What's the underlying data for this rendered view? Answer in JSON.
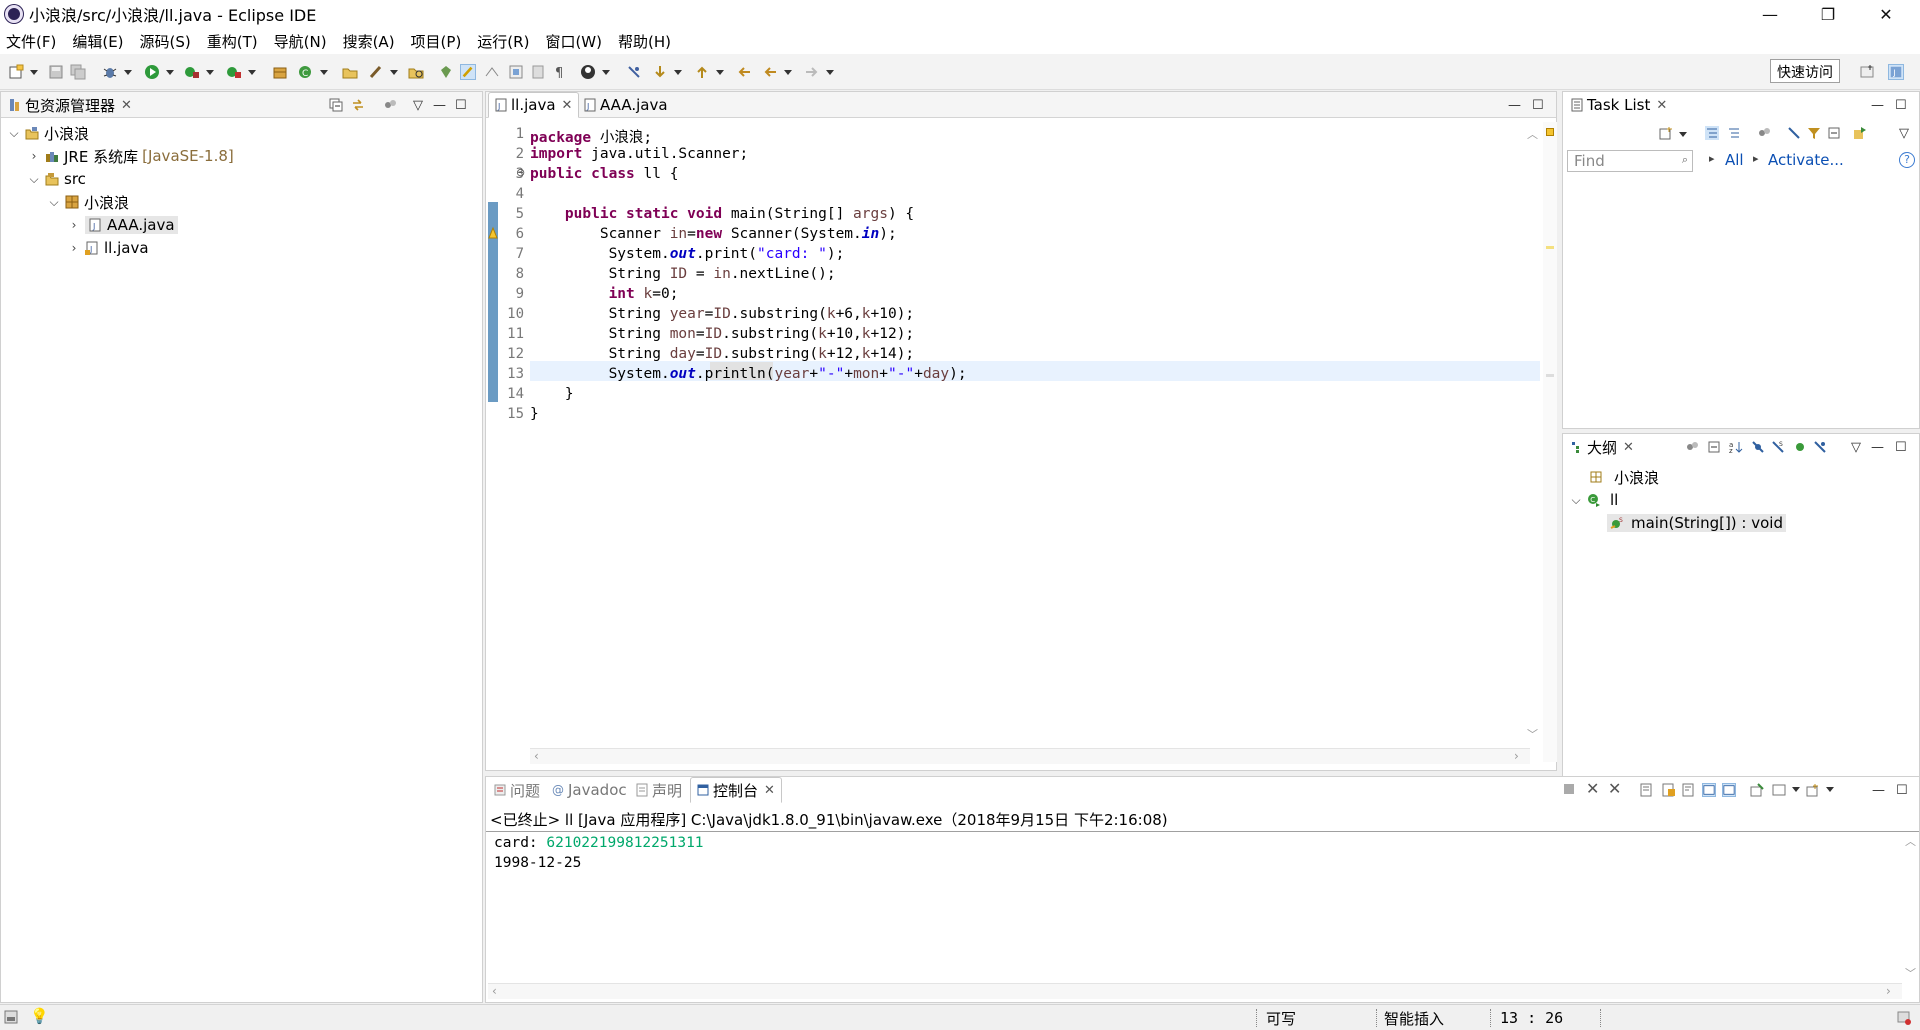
{
  "window": {
    "title": "小浪浪/src/小浪浪/ll.java - Eclipse IDE",
    "minimize": "—",
    "restore": "❐",
    "close": "✕"
  },
  "menu": [
    "文件(F)",
    "编辑(E)",
    "源码(S)",
    "重构(T)",
    "导航(N)",
    "搜索(A)",
    "项目(P)",
    "运行(R)",
    "窗口(W)",
    "帮助(H)"
  ],
  "toolbar": {
    "quick_access": "快速访问"
  },
  "package_explorer": {
    "tab_label": "包资源管理器",
    "tree": [
      {
        "label": "小浪浪",
        "level": 0,
        "expanded": true,
        "icon": "project-icon"
      },
      {
        "label": "JRE 系统库",
        "suffix": "[JavaSE-1.8]",
        "level": 1,
        "expanded": false,
        "icon": "library-icon"
      },
      {
        "label": "src",
        "level": 1,
        "expanded": true,
        "icon": "source-folder-icon"
      },
      {
        "label": "小浪浪",
        "level": 2,
        "expanded": true,
        "icon": "package-icon"
      },
      {
        "label": "AAA.java",
        "level": 3,
        "expanded": false,
        "icon": "java-file-icon",
        "selected": true
      },
      {
        "label": "ll.java",
        "level": 3,
        "expanded": false,
        "icon": "java-file-icon"
      }
    ]
  },
  "editor": {
    "tabs": [
      {
        "label": "ll.java",
        "active": true
      },
      {
        "label": "AAA.java",
        "active": false
      }
    ],
    "line_numbers": [
      "1",
      "2",
      "3",
      "4",
      "5",
      "6",
      "7",
      "8",
      "9",
      "10",
      "11",
      "12",
      "13",
      "14",
      "15"
    ],
    "lines": [
      [
        [
          "kw",
          "package"
        ],
        [
          "t",
          " 小浪浪;"
        ]
      ],
      [
        [
          "kw",
          "import"
        ],
        [
          "t",
          " java.util.Scanner;"
        ]
      ],
      [
        [
          "kw",
          "public"
        ],
        [
          "t",
          " "
        ],
        [
          "kw",
          "class"
        ],
        [
          "t",
          " ll {"
        ]
      ],
      [
        [
          "t",
          ""
        ]
      ],
      [
        [
          "t",
          "    "
        ],
        [
          "kw",
          "public"
        ],
        [
          "t",
          " "
        ],
        [
          "kw",
          "static"
        ],
        [
          "t",
          " "
        ],
        [
          "kw",
          "void"
        ],
        [
          "t",
          " main(String[] "
        ],
        [
          "var",
          "args"
        ],
        [
          "t",
          ") {"
        ]
      ],
      [
        [
          "t",
          "        Scanner "
        ],
        [
          "var",
          "in"
        ],
        [
          "t",
          "="
        ],
        [
          "kw",
          "new"
        ],
        [
          "t",
          " Scanner(System."
        ],
        [
          "fld",
          "in"
        ],
        [
          "t",
          ");"
        ]
      ],
      [
        [
          "t",
          "         System."
        ],
        [
          "fld",
          "out"
        ],
        [
          "t",
          ".print("
        ],
        [
          "str",
          "\"card: \""
        ],
        [
          "t",
          ");"
        ]
      ],
      [
        [
          "t",
          "         String "
        ],
        [
          "var",
          "ID"
        ],
        [
          "t",
          " = "
        ],
        [
          "var",
          "in"
        ],
        [
          "t",
          ".nextLine();"
        ]
      ],
      [
        [
          "t",
          "         "
        ],
        [
          "kw",
          "int"
        ],
        [
          "t",
          " "
        ],
        [
          "var",
          "k"
        ],
        [
          "t",
          "=0;"
        ]
      ],
      [
        [
          "t",
          "         String "
        ],
        [
          "var",
          "year"
        ],
        [
          "t",
          "="
        ],
        [
          "var",
          "ID"
        ],
        [
          "t",
          ".substring("
        ],
        [
          "var",
          "k"
        ],
        [
          "t",
          "+6,"
        ],
        [
          "var",
          "k"
        ],
        [
          "t",
          "+10);"
        ]
      ],
      [
        [
          "t",
          "         String "
        ],
        [
          "var",
          "mon"
        ],
        [
          "t",
          "="
        ],
        [
          "var",
          "ID"
        ],
        [
          "t",
          ".substring("
        ],
        [
          "var",
          "k"
        ],
        [
          "t",
          "+10,"
        ],
        [
          "var",
          "k"
        ],
        [
          "t",
          "+12);"
        ]
      ],
      [
        [
          "t",
          "         String "
        ],
        [
          "var",
          "day"
        ],
        [
          "t",
          "="
        ],
        [
          "var",
          "ID"
        ],
        [
          "t",
          ".substring("
        ],
        [
          "var",
          "k"
        ],
        [
          "t",
          "+12,"
        ],
        [
          "var",
          "k"
        ],
        [
          "t",
          "+14);"
        ]
      ],
      [
        [
          "t",
          "         System."
        ],
        [
          "fld",
          "out"
        ],
        [
          "t",
          ".println("
        ],
        [
          "var",
          "year"
        ],
        [
          "t",
          "+"
        ],
        [
          "str",
          "\"-\""
        ],
        [
          "t",
          "+"
        ],
        [
          "var",
          "mon"
        ],
        [
          "t",
          "+"
        ],
        [
          "str",
          "\"-\""
        ],
        [
          "t",
          "+"
        ],
        [
          "var",
          "day"
        ],
        [
          "t",
          ");"
        ]
      ],
      [
        [
          "t",
          "    }"
        ]
      ],
      [
        [
          "t",
          "}"
        ]
      ]
    ],
    "fold_marker": "⊖"
  },
  "task_list": {
    "tab_label": "Task List",
    "find_placeholder": "Find",
    "all_label": "All",
    "activate_label": "Activate...",
    "help": "?"
  },
  "outline": {
    "tab_label": "大纲",
    "items": [
      {
        "label": "小浪浪",
        "icon": "package-decl-icon"
      },
      {
        "label": "ll",
        "icon": "class-icon"
      },
      {
        "label": "main(String[]) : void",
        "icon": "method-icon"
      }
    ]
  },
  "bottom_panel": {
    "tabs": [
      {
        "label": "问题",
        "icon": "problems-icon",
        "active": false
      },
      {
        "label": "Javadoc",
        "icon": "javadoc-icon",
        "active": false
      },
      {
        "label": "声明",
        "icon": "declaration-icon",
        "active": false
      },
      {
        "label": "控制台",
        "icon": "console-icon",
        "active": true
      }
    ],
    "console_header": "<已终止> ll [Java 应用程序] C:\\Java\\jdk1.8.0_91\\bin\\javaw.exe（2018年9月15日 下午2:16:08)",
    "output_prompt": "card: ",
    "output_input": "621022199812251311",
    "output_line2": "1998-12-25"
  },
  "status_bar": {
    "writable": "可写",
    "insert_mode": "智能插入",
    "position": "13 : 26"
  },
  "colors": {
    "keyword": "#7f0055",
    "string": "#2a00ff",
    "field": "#0000c0",
    "console_input": "#00a86b",
    "selection": "#e8e8e8"
  }
}
